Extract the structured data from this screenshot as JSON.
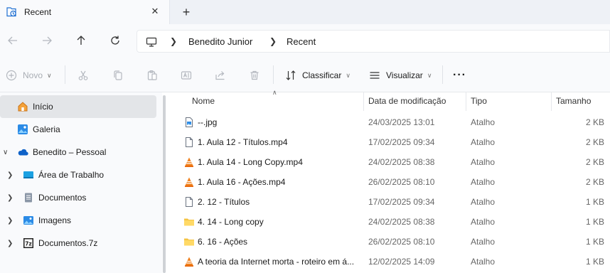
{
  "tab": {
    "title": "Recent",
    "close_symbol": "✕",
    "new_symbol": "+"
  },
  "address": {
    "segments": [
      "Benedito Junior",
      "Recent"
    ]
  },
  "toolbar": {
    "new_label": "Novo",
    "sort_label": "Classificar",
    "view_label": "Visualizar",
    "more_label": "···"
  },
  "sidebar": {
    "items": [
      {
        "label": "Início",
        "icon": "home-icon",
        "selected": true
      },
      {
        "label": "Galeria",
        "icon": "gallery-icon"
      },
      {
        "label": "Benedito – Pessoal",
        "icon": "onedrive-icon",
        "expanded": true
      },
      {
        "label": "Área de Trabalho",
        "icon": "desktop-folder-icon"
      },
      {
        "label": "Documentos",
        "icon": "documents-folder-icon"
      },
      {
        "label": "Imagens",
        "icon": "pictures-folder-icon"
      },
      {
        "label": "Documentos.7z",
        "icon": "archive-icon"
      }
    ]
  },
  "columns": {
    "name": "Nome",
    "date": "Data de modificação",
    "type": "Tipo",
    "size": "Tamanho"
  },
  "files": [
    {
      "name": "--.jpg",
      "date": "24/03/2025 13:01",
      "type": "Atalho",
      "size": "2 KB",
      "icon": "image-file-icon"
    },
    {
      "name": "1. Aula 12 - Títulos.mp4",
      "date": "17/02/2025 09:34",
      "type": "Atalho",
      "size": "2 KB",
      "icon": "file-icon"
    },
    {
      "name": "1. Aula 14 - Long Copy.mp4",
      "date": "24/02/2025 08:38",
      "type": "Atalho",
      "size": "2 KB",
      "icon": "vlc-icon"
    },
    {
      "name": "1. Aula 16 - Ações.mp4",
      "date": "26/02/2025 08:10",
      "type": "Atalho",
      "size": "2 KB",
      "icon": "vlc-icon"
    },
    {
      "name": "2. 12 - Títulos",
      "date": "17/02/2025 09:34",
      "type": "Atalho",
      "size": "1 KB",
      "icon": "file-icon"
    },
    {
      "name": "4. 14 - Long copy",
      "date": "24/02/2025 08:38",
      "type": "Atalho",
      "size": "1 KB",
      "icon": "folder-icon"
    },
    {
      "name": "6. 16 - Ações",
      "date": "26/02/2025 08:10",
      "type": "Atalho",
      "size": "1 KB",
      "icon": "folder-icon"
    },
    {
      "name": "A teoria da Internet morta - roteiro em á...",
      "date": "12/02/2025 14:09",
      "type": "Atalho",
      "size": "1 KB",
      "icon": "vlc-icon"
    }
  ]
}
